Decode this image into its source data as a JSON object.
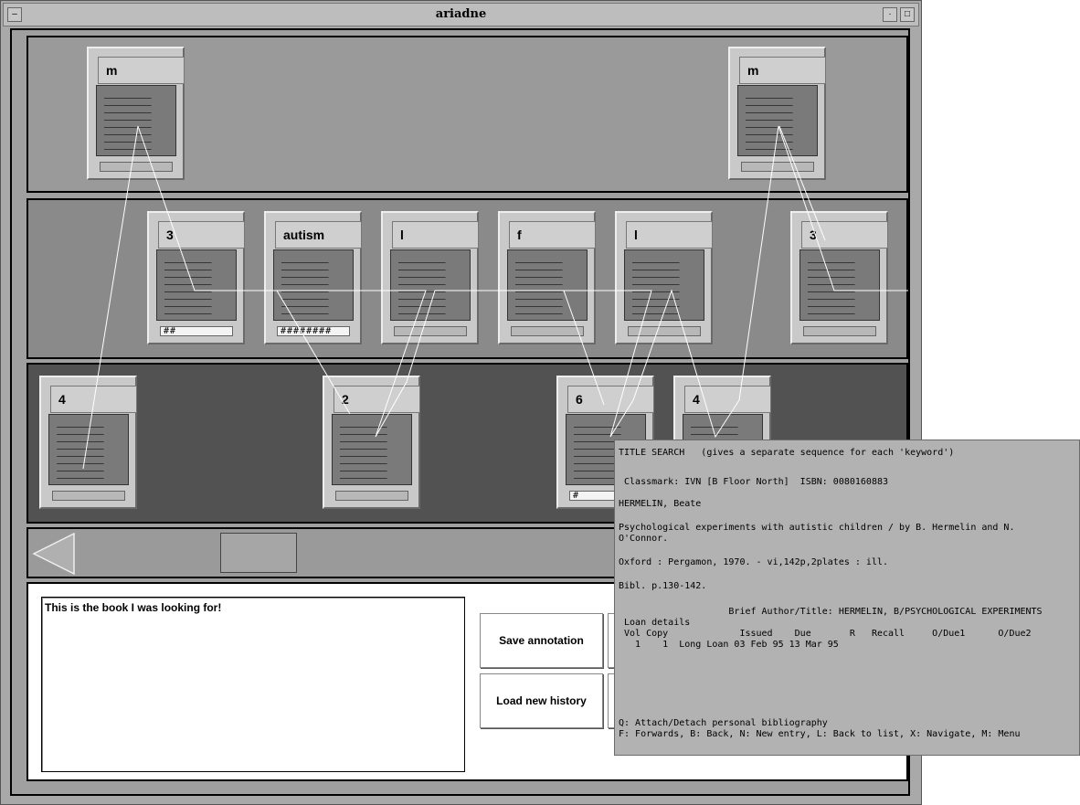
{
  "window": {
    "title": "ariadne"
  },
  "rows": {
    "top": [
      {
        "label": "m",
        "field": ""
      },
      {
        "label": "m",
        "field": ""
      }
    ],
    "middle": [
      {
        "label": "3",
        "field": "##"
      },
      {
        "label": "autism",
        "field": "########"
      },
      {
        "label": "l",
        "field": ""
      },
      {
        "label": "f",
        "field": ""
      },
      {
        "label": "l",
        "field": ""
      },
      {
        "label": "3",
        "field": ""
      }
    ],
    "bottom": [
      {
        "label": "4",
        "field": ""
      },
      {
        "label": "2",
        "field": ""
      },
      {
        "label": "6",
        "field": "#"
      },
      {
        "label": "4",
        "field": ""
      }
    ]
  },
  "annotation": {
    "text": "This is the book I was looking for!"
  },
  "buttons": {
    "save": "Save annotation",
    "load": "Load new history"
  },
  "popup": {
    "lines": [
      "TITLE SEARCH   (gives a separate sequence for each 'keyword')",
      " Classmark: IVN [B Floor North]  ISBN: 0080160883",
      "HERMELIN, Beate",
      "Psychological experiments with autistic children / by B. Hermelin and N.",
      "O'Connor.",
      "Oxford : Pergamon, 1970. - vi,142p,2plates : ill.",
      "Bibl. p.130-142.",
      "                    Brief Author/Title: HERMELIN, B/PSYCHOLOGICAL EXPERIMENTS",
      " Loan details",
      " Vol Copy             Issued    Due       R   Recall     O/Due1      O/Due2",
      "   1    1  Long Loan 03 Feb 95 13 Mar 95",
      "Q: Attach/Detach personal bibliography",
      "F: Forwards, B: Back, N: New entry, L: Back to list, X: Navigate, M: Menu"
    ]
  }
}
